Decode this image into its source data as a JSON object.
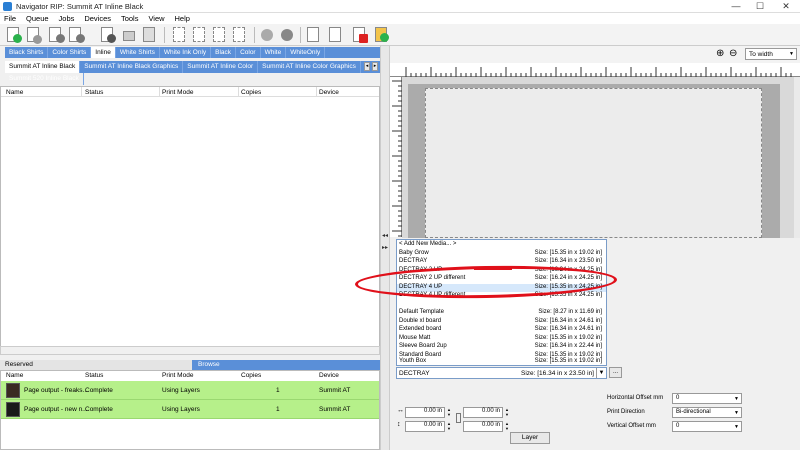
{
  "window": {
    "title": "Navigator RIP: Summit AT Inline Black",
    "min": "—",
    "max": "☐",
    "close": "✕"
  },
  "menu": [
    "File",
    "Queue",
    "Jobs",
    "Devices",
    "Tools",
    "View",
    "Help"
  ],
  "tabs_row1": [
    "Black Shirts",
    "Color Shirts",
    "Inline",
    "White Shirts",
    "White Ink Only",
    "Black",
    "Color",
    "White",
    "WhiteOnly"
  ],
  "tabs_row1_active": 2,
  "tabs_row2": [
    "Summit AT Inline Black",
    "Summit AT Inline Black Graphics",
    "Summit AT Inline Color",
    "Summit AT Inline Color Graphics",
    "Summit 520 Inline Black"
  ],
  "tabs_row2_active": 0,
  "queue_columns": [
    "Name",
    "Status",
    "Print Mode",
    "Copies",
    "Device"
  ],
  "reserved": {
    "label": "Reserved",
    "browse": "Browse"
  },
  "reserved_columns": [
    "Name",
    "Status",
    "Print Mode",
    "Copies",
    "Device"
  ],
  "reserved_rows": [
    {
      "name": "Page output - freaks...",
      "status": "Complete",
      "mode": "Using Layers",
      "copies": "1",
      "device": "Summit AT"
    },
    {
      "name": "Page output - new n...",
      "status": "Complete",
      "mode": "Using Layers",
      "copies": "1",
      "device": "Summit AT"
    }
  ],
  "zoom": {
    "value": "To width"
  },
  "media_list": [
    {
      "name": "< Add New Media... >",
      "size": ""
    },
    {
      "name": "Baby Grow",
      "size": "Size: [15.35 in x 19.02 in]"
    },
    {
      "name": "DECTRAY",
      "size": "Size: [16.34 in x 23.50 in]"
    },
    {
      "name": "DECTRAY 2 UP",
      "size": "Size: [16.24 in x 24.25 in]"
    },
    {
      "name": "DECTRAY 2 UP different",
      "size": "Size: [16.24 in x 24.25 in]"
    },
    {
      "name": "DECTRAY 4 UP",
      "size": "Size: [15.35 in x 24.25 in]"
    },
    {
      "name": "DECTRAY 4 UP different",
      "size": "Size: [15.35 in x 24.25 in]"
    },
    {
      "name": "",
      "size": ""
    },
    {
      "name": "Default Template",
      "size": "Size: [8.27 in x 11.69 in]"
    },
    {
      "name": "Double xl board",
      "size": "Size: [16.34 in x 24.61 in]"
    },
    {
      "name": "Extended board",
      "size": "Size: [16.34 in x 24.61 in]"
    },
    {
      "name": "Mouse Matt",
      "size": "Size: [15.35 in x 19.02 in]"
    },
    {
      "name": "Sleeve Board 2up",
      "size": "Size: [16.34 in x 22.44 in]"
    },
    {
      "name": "Standard Board",
      "size": "Size: [15.35 in x 19.02 in]"
    },
    {
      "name": "Youth Box",
      "size": "Size: [15.35 in x 19.02 in]"
    }
  ],
  "media_selected": {
    "name": "DECTRAY",
    "size": "Size: [16.34 in x 23.50 in]"
  },
  "more_button": "...",
  "offsets": {
    "v1": "0.00 in",
    "v2": "0.00 in",
    "v3": "0.00 in",
    "v4": "0.00 in"
  },
  "settings": {
    "hoff_label": "Horizontal Offset mm",
    "hoff_value": "0",
    "dir_label": "Print Direction",
    "dir_value": "Bi-directional",
    "voff_label": "Vertical Offset mm",
    "voff_value": "0"
  },
  "layer_button": "Layer",
  "splitter": {
    "top_arrows": "◂◂",
    "mid_arrows": "▸▸"
  }
}
